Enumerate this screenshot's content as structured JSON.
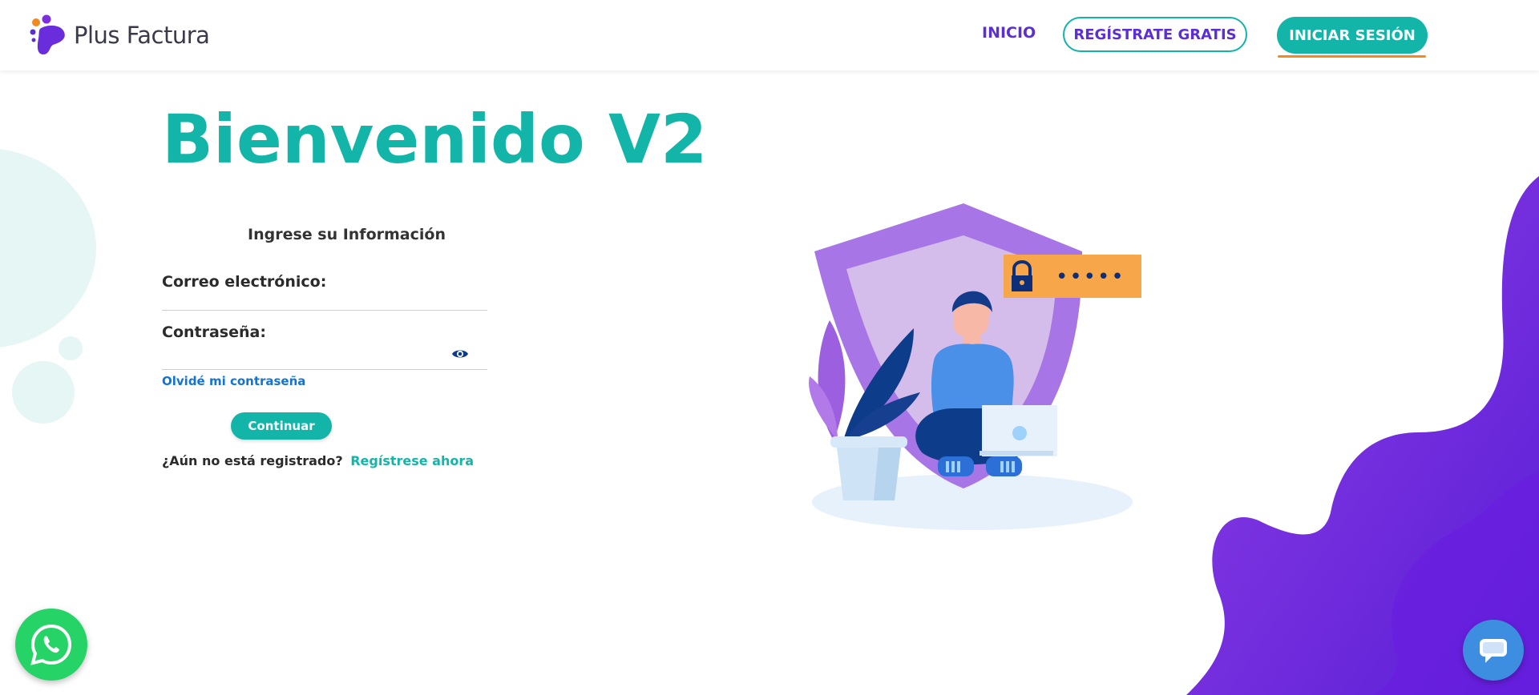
{
  "brand": {
    "name": "Plus Factura"
  },
  "nav": {
    "home": "INICIO",
    "register": "REGÍSTRATE GRATIS",
    "login": "INICIAR SESIÓN"
  },
  "page": {
    "title": "Bienvenido V2",
    "form_heading": "Ingrese su Información",
    "email_label": "Correo electrónico:",
    "email_value": "",
    "password_label": "Contraseña:",
    "password_value": "",
    "forgot_password": "Olvidé mi contraseña",
    "continue_button": "Continuar",
    "not_registered": "¿Aún no está registrado?",
    "register_now": "Regístrese ahora"
  },
  "illustration": {
    "password_mask": "•••••"
  },
  "colors": {
    "teal": "#13b5a9",
    "purple": "#5b2fd1",
    "orange": "#f18a1f",
    "link_blue": "#1273d4",
    "whatsapp_green": "#25d366",
    "chat_blue": "#3d8ee0"
  },
  "icons": {
    "logo": "plus-factura-logo-icon",
    "eye": "eye-icon",
    "whatsapp": "whatsapp-icon",
    "chat": "chat-bubble-icon",
    "lock": "lock-icon"
  }
}
